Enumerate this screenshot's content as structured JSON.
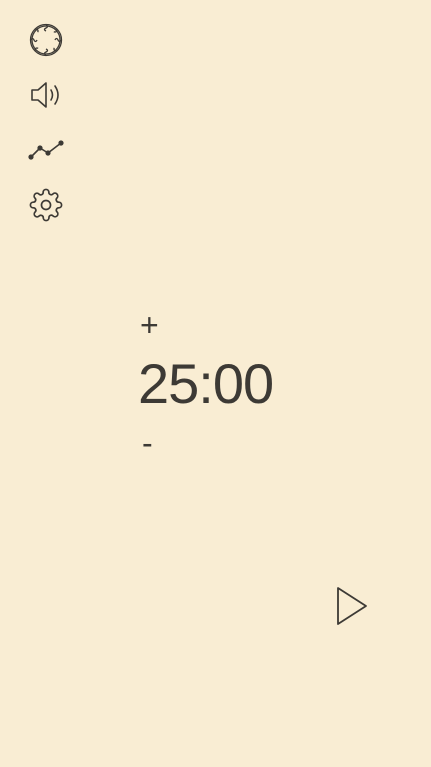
{
  "sidebar": {
    "items": [
      {
        "icon": "pattern-icon"
      },
      {
        "icon": "speaker-icon"
      },
      {
        "icon": "stats-chart-icon"
      },
      {
        "icon": "gear-icon"
      }
    ]
  },
  "timer": {
    "increment_label": "+",
    "time": "25:00",
    "decrement_label": "-"
  },
  "controls": {
    "play_icon": "play-icon"
  },
  "colors": {
    "background": "#f9edd3",
    "foreground": "#3d3a35"
  }
}
